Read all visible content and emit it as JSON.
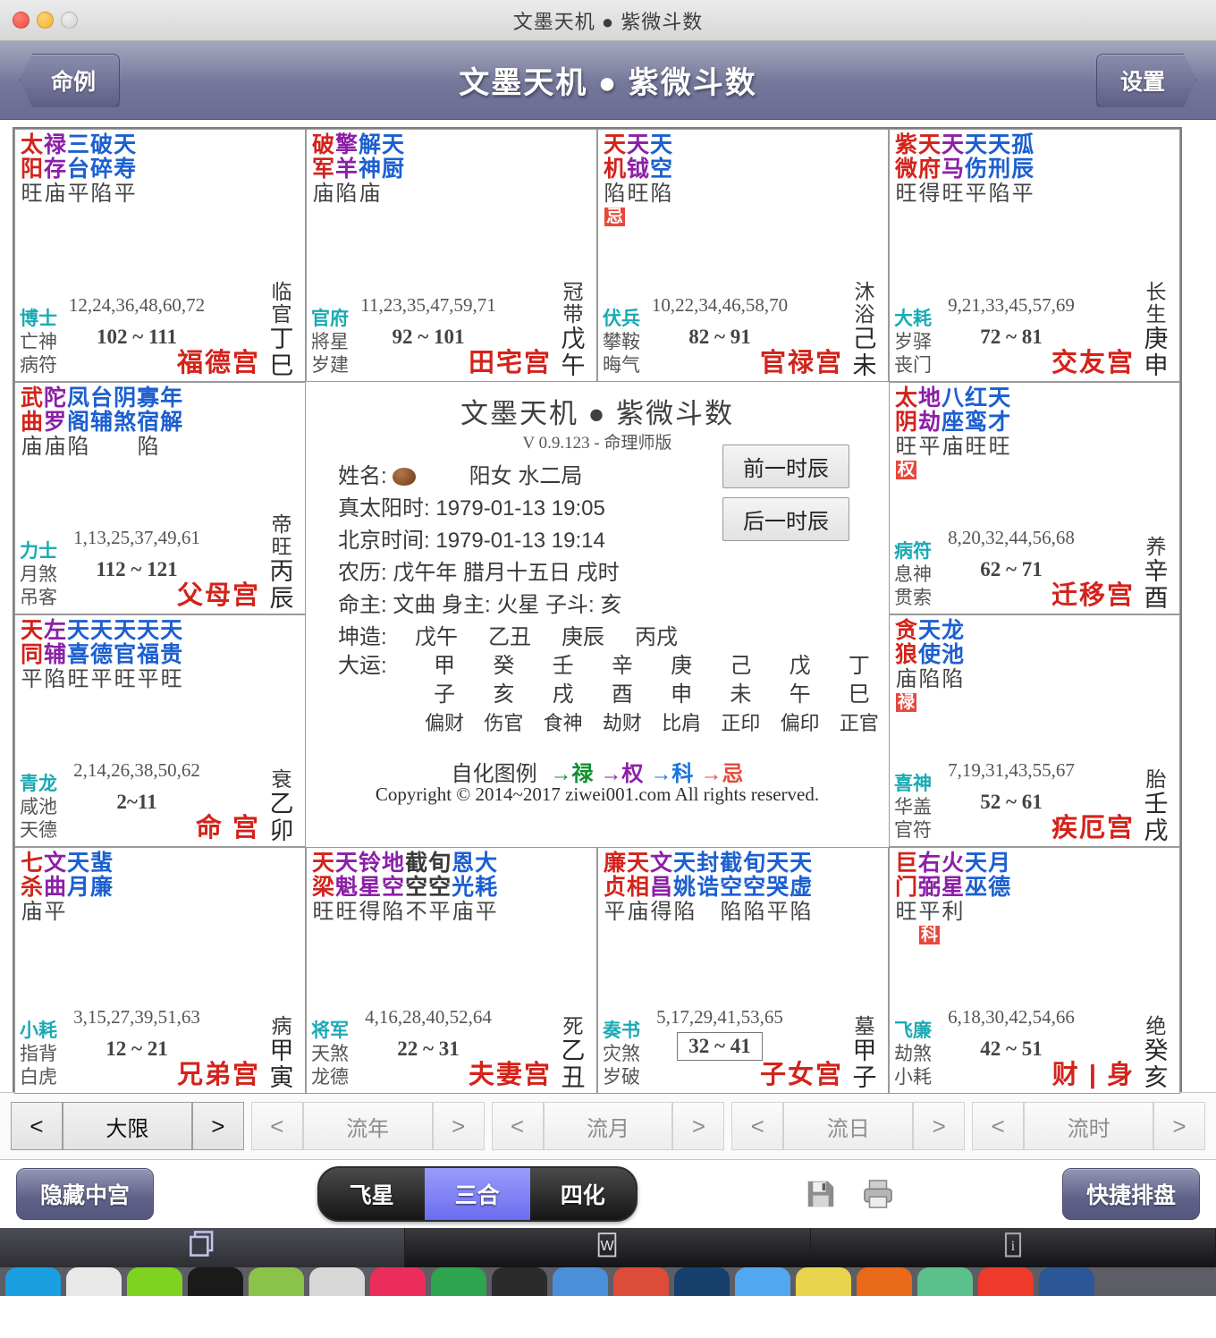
{
  "window": {
    "title": "文墨天机 ● 紫微斗数"
  },
  "header": {
    "title": "文墨天机 ● 紫微斗数",
    "left_button": "命例",
    "right_button": "设置"
  },
  "center": {
    "title": "文墨天机 ● 紫微斗数",
    "version": "V 0.9.123 - 命理师版",
    "name_label": "姓名:",
    "gender_ju": "阳女 水二局",
    "true_solar_label": "真太阳时:",
    "true_solar_value": "1979-01-13 19:05",
    "beijing_label": "北京时间:",
    "beijing_value": "1979-01-13 19:14",
    "lunar_label": "农历:",
    "lunar_value": "戊午年 腊月十五日 戌时",
    "masters": "命主: 文曲 身主: 火星 子斗: 亥",
    "kunzao_label": "坤造:",
    "kunzao": [
      "戊午",
      "乙丑",
      "庚辰",
      "丙戌"
    ],
    "dayun_label": "大运:",
    "dayun_gan": [
      "甲",
      "癸",
      "壬",
      "辛",
      "庚",
      "己",
      "戊",
      "丁"
    ],
    "dayun_zhi": [
      "子",
      "亥",
      "戌",
      "酉",
      "申",
      "未",
      "午",
      "巳"
    ],
    "dayun_shishen": [
      "偏财",
      "伤官",
      "食神",
      "劫财",
      "比肩",
      "正印",
      "偏印",
      "正官"
    ],
    "legend_label": "自化图例",
    "legend_items": [
      {
        "arrow": "→",
        "text": "禄",
        "color": "#0e8f2e"
      },
      {
        "arrow": "→",
        "text": "权",
        "color": "#8c1fa8"
      },
      {
        "arrow": "→",
        "text": "科",
        "color": "#1c72e0"
      },
      {
        "arrow": "→",
        "text": "忌",
        "color": "#e8483c"
      }
    ],
    "copyright": "Copyright © 2014~2017 ziwei001.com All rights reserved.",
    "prev_hour_button": "前一时辰",
    "next_hour_button": "后一时辰"
  },
  "palaces": [
    {
      "id": "fude",
      "stars": [
        {
          "name": "太阳",
          "color": "red",
          "bright": "旺"
        },
        {
          "name": "禄存",
          "color": "purple",
          "bright": "庙"
        },
        {
          "name": "三台",
          "color": "blue",
          "bright": "平"
        },
        {
          "name": "破碎",
          "color": "blue",
          "bright": "陷"
        },
        {
          "name": "天寿",
          "color": "blue",
          "bright": "平"
        }
      ],
      "sihua": "",
      "ages": "12,24,36,48,60,72",
      "daxian": "102 ~ 111",
      "boxed": false,
      "left": [
        "博士",
        "亡神",
        "病符"
      ],
      "palace_name": "福德宫",
      "twelve": "临官",
      "ganzhi": "丁巳"
    },
    {
      "id": "tianzhai",
      "stars": [
        {
          "name": "破军",
          "color": "red",
          "bright": "庙"
        },
        {
          "name": "擎羊",
          "color": "purple",
          "bright": "陷"
        },
        {
          "name": "解神",
          "color": "blue",
          "bright": "庙"
        },
        {
          "name": "天厨",
          "color": "blue",
          "bright": ""
        }
      ],
      "sihua": "",
      "ages": "11,23,35,47,59,71",
      "daxian": "92 ~ 101",
      "boxed": false,
      "left": [
        "官府",
        "將星",
        "岁建"
      ],
      "palace_name": "田宅宫",
      "twelve": "冠带",
      "ganzhi": "戊午"
    },
    {
      "id": "guanlu",
      "stars": [
        {
          "name": "天机",
          "color": "red",
          "bright": "陷"
        },
        {
          "name": "天钺",
          "color": "purple",
          "bright": "旺"
        },
        {
          "name": "天空",
          "color": "blue",
          "bright": "陷"
        }
      ],
      "sihua": "忌",
      "ages": "10,22,34,46,58,70",
      "daxian": "82 ~ 91",
      "boxed": false,
      "left": [
        "伏兵",
        "攀鞍",
        "晦气"
      ],
      "palace_name": "官禄宫",
      "twelve": "沐浴",
      "ganzhi": "己未"
    },
    {
      "id": "jiaoyou",
      "stars": [
        {
          "name": "紫微",
          "color": "red",
          "bright": "旺"
        },
        {
          "name": "天府",
          "color": "red",
          "bright": "得"
        },
        {
          "name": "天马",
          "color": "purple",
          "bright": "旺"
        },
        {
          "name": "天伤",
          "color": "blue",
          "bright": "平"
        },
        {
          "name": "天刑",
          "color": "blue",
          "bright": "陷"
        },
        {
          "name": "孤辰",
          "color": "blue",
          "bright": "平"
        }
      ],
      "sihua": "",
      "ages": "9,21,33,45,57,69",
      "daxian": "72 ~ 81",
      "boxed": false,
      "left": [
        "大耗",
        "岁驿",
        "丧门"
      ],
      "palace_name": "交友宫",
      "twelve": "长生",
      "ganzhi": "庚申"
    },
    {
      "id": "fumu",
      "stars": [
        {
          "name": "武曲",
          "color": "red",
          "bright": "庙"
        },
        {
          "name": "陀罗",
          "color": "purple",
          "bright": "庙"
        },
        {
          "name": "凤阁",
          "color": "blue",
          "bright": "陷"
        },
        {
          "name": "台辅",
          "color": "blue",
          "bright": ""
        },
        {
          "name": "阴煞",
          "color": "blue",
          "bright": ""
        },
        {
          "name": "寡宿",
          "color": "blue",
          "bright": "陷"
        },
        {
          "name": "年解",
          "color": "blue",
          "bright": ""
        }
      ],
      "sihua": "",
      "ages": "1,13,25,37,49,61",
      "daxian": "112 ~ 121",
      "boxed": false,
      "left": [
        "力士",
        "月煞",
        "吊客"
      ],
      "palace_name": "父母宫",
      "twelve": "帝旺",
      "ganzhi": "丙辰"
    },
    {
      "id": "qianyi",
      "stars": [
        {
          "name": "太阴",
          "color": "red",
          "bright": "旺"
        },
        {
          "name": "地劫",
          "color": "purple",
          "bright": "平"
        },
        {
          "name": "八座",
          "color": "blue",
          "bright": "庙"
        },
        {
          "name": "红鸾",
          "color": "blue",
          "bright": "旺"
        },
        {
          "name": "天才",
          "color": "blue",
          "bright": "旺"
        }
      ],
      "sihua": "权",
      "ages": "8,20,32,44,56,68",
      "daxian": "62 ~ 71",
      "boxed": false,
      "left": [
        "病符",
        "息神",
        "贯索"
      ],
      "palace_name": "迁移宫",
      "twelve": "养",
      "ganzhi": "辛酉"
    },
    {
      "id": "ming",
      "stars": [
        {
          "name": "天同",
          "color": "red",
          "bright": "平"
        },
        {
          "name": "左辅",
          "color": "purple",
          "bright": "陷"
        },
        {
          "name": "天喜",
          "color": "blue",
          "bright": "旺"
        },
        {
          "name": "天德",
          "color": "blue",
          "bright": "平"
        },
        {
          "name": "天官",
          "color": "blue",
          "bright": "旺"
        },
        {
          "name": "天福",
          "color": "blue",
          "bright": "平"
        },
        {
          "name": "天贵",
          "color": "blue",
          "bright": "旺"
        }
      ],
      "sihua": "",
      "ages": "2,14,26,38,50,62",
      "daxian": "2~11",
      "boxed": false,
      "left": [
        "青龙",
        "咸池",
        "天德"
      ],
      "palace_name": "命 宫",
      "twelve": "衰",
      "ganzhi": "乙卯"
    },
    {
      "id": "jie",
      "stars": [
        {
          "name": "贪狼",
          "color": "red",
          "bright": "庙"
        },
        {
          "name": "天使",
          "color": "blue",
          "bright": "陷"
        },
        {
          "name": "龙池",
          "color": "blue",
          "bright": "陷"
        }
      ],
      "sihua": "禄",
      "ages": "7,19,31,43,55,67",
      "daxian": "52 ~ 61",
      "boxed": false,
      "left": [
        "喜神",
        "华盖",
        "官符"
      ],
      "palace_name": "疾厄宫",
      "twelve": "胎",
      "ganzhi": "壬戌"
    },
    {
      "id": "xiongdi",
      "stars": [
        {
          "name": "七杀",
          "color": "red",
          "bright": "庙"
        },
        {
          "name": "文曲",
          "color": "purple",
          "bright": "平"
        },
        {
          "name": "天月",
          "color": "blue",
          "bright": ""
        },
        {
          "name": "蜚廉",
          "color": "blue",
          "bright": ""
        }
      ],
      "sihua": "",
      "ages": "3,15,27,39,51,63",
      "daxian": "12 ~ 21",
      "boxed": false,
      "left": [
        "小耗",
        "指背",
        "白虎"
      ],
      "palace_name": "兄弟宫",
      "twelve": "病",
      "ganzhi": "甲寅"
    },
    {
      "id": "fuqi",
      "stars": [
        {
          "name": "天梁",
          "color": "red",
          "bright": "旺"
        },
        {
          "name": "天魁",
          "color": "purple",
          "bright": "旺"
        },
        {
          "name": "铃星",
          "color": "purple",
          "bright": "得"
        },
        {
          "name": "地空",
          "color": "purple",
          "bright": "陷"
        },
        {
          "name": "截空",
          "color": "black",
          "bright": "不"
        },
        {
          "name": "旬空",
          "color": "black",
          "bright": "平"
        },
        {
          "name": "恩光",
          "color": "blue",
          "bright": "庙"
        },
        {
          "name": "大耗",
          "color": "blue",
          "bright": "平"
        }
      ],
      "sihua": "",
      "ages": "4,16,28,40,52,64",
      "daxian": "22 ~ 31",
      "boxed": false,
      "left": [
        "将军",
        "天煞",
        "龙德"
      ],
      "palace_name": "夫妻宫",
      "twelve": "死",
      "ganzhi": "乙丑"
    },
    {
      "id": "zinv",
      "stars": [
        {
          "name": "廉贞",
          "color": "red",
          "bright": "平"
        },
        {
          "name": "天相",
          "color": "red",
          "bright": "庙"
        },
        {
          "name": "文昌",
          "color": "purple",
          "bright": "得"
        },
        {
          "name": "天姚",
          "color": "blue",
          "bright": "陷"
        },
        {
          "name": "封诰",
          "color": "blue",
          "bright": ""
        },
        {
          "name": "截空",
          "color": "blue",
          "bright": "陷"
        },
        {
          "name": "旬空",
          "color": "blue",
          "bright": "陷"
        },
        {
          "name": "天哭",
          "color": "blue",
          "bright": "平"
        },
        {
          "name": "天虚",
          "color": "blue",
          "bright": "陷"
        }
      ],
      "sihua": "",
      "ages": "5,17,29,41,53,65",
      "daxian": "32 ~ 41",
      "boxed": true,
      "left": [
        "奏书",
        "灾煞",
        "岁破"
      ],
      "palace_name": "子女宫",
      "twelve": "墓",
      "ganzhi": "甲子"
    },
    {
      "id": "caibo",
      "stars": [
        {
          "name": "巨门",
          "color": "red",
          "bright": "旺"
        },
        {
          "name": "右弼",
          "color": "purple",
          "bright": "平"
        },
        {
          "name": "火星",
          "color": "purple",
          "bright": "利"
        },
        {
          "name": "天巫",
          "color": "blue",
          "bright": ""
        },
        {
          "name": "月德",
          "color": "blue",
          "bright": ""
        }
      ],
      "sihua": "科",
      "sihua_offset": 1,
      "ages": "6,18,30,42,54,66",
      "daxian": "42 ~ 51",
      "boxed": false,
      "left": [
        "飞廉",
        "劫煞",
        "小耗"
      ],
      "palace_name": "财 | 身",
      "twelve": "绝",
      "ganzhi": "癸亥"
    }
  ],
  "navbar": [
    {
      "id": "daxian",
      "label": "大限",
      "prev": "<",
      "next": ">",
      "active": true
    },
    {
      "id": "liunian",
      "label": "流年",
      "prev": "<",
      "next": ">",
      "active": false
    },
    {
      "id": "liuyue",
      "label": "流月",
      "prev": "<",
      "next": ">",
      "active": false
    },
    {
      "id": "liuri",
      "label": "流日",
      "prev": "<",
      "next": ">",
      "active": false
    },
    {
      "id": "liushi",
      "label": "流时",
      "prev": "<",
      "next": ">",
      "active": false
    }
  ],
  "toolbar": {
    "hide_center": "隐藏中宫",
    "segments": [
      {
        "label": "飞星",
        "selected": false
      },
      {
        "label": "三合",
        "selected": true
      },
      {
        "label": "四化",
        "selected": false
      }
    ],
    "save_icon": "save-icon",
    "print_icon": "print-icon",
    "quick_chart": "快捷排盘"
  },
  "colors": {
    "star_red": "#d3231b",
    "star_purple": "#8c1fa8",
    "star_blue": "#1c5fd0",
    "teal": "#19aab4",
    "palace_red": "#d3231b",
    "accent_purple": "#6b6df0",
    "header_purple": "#74769a"
  }
}
